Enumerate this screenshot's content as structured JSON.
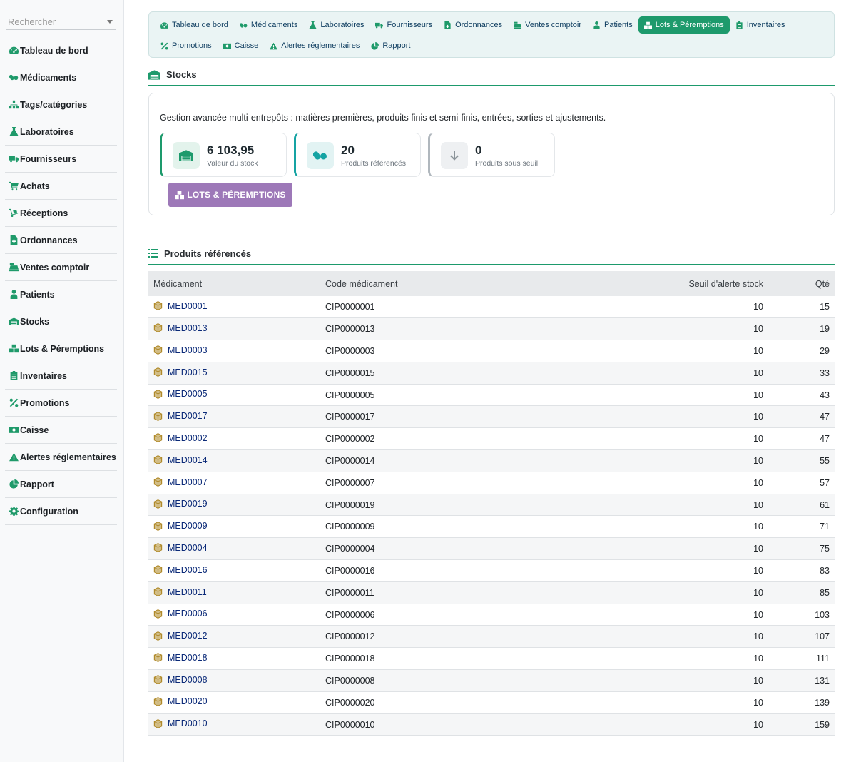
{
  "sidebar": {
    "search_placeholder": "Rechercher",
    "items": [
      {
        "label": "Tableau de bord",
        "icon": "dashboard-icon"
      },
      {
        "label": "Médicaments",
        "icon": "pills-icon"
      },
      {
        "label": "Tags/catégories",
        "icon": "sitemap-icon"
      },
      {
        "label": "Laboratoires",
        "icon": "flask-icon"
      },
      {
        "label": "Fournisseurs",
        "icon": "truck-icon"
      },
      {
        "label": "Achats",
        "icon": "cart-icon"
      },
      {
        "label": "Réceptions",
        "icon": "dolly-icon"
      },
      {
        "label": "Ordonnances",
        "icon": "prescription-icon"
      },
      {
        "label": "Ventes comptoir",
        "icon": "cash-register-icon"
      },
      {
        "label": "Patients",
        "icon": "patient-icon"
      },
      {
        "label": "Stocks",
        "icon": "warehouse-icon"
      },
      {
        "label": "Lots & Péremptions",
        "icon": "boxes-icon"
      },
      {
        "label": "Inventaires",
        "icon": "clipboard-icon"
      },
      {
        "label": "Promotions",
        "icon": "percent-icon"
      },
      {
        "label": "Caisse",
        "icon": "money-icon"
      },
      {
        "label": "Alertes réglementaires",
        "icon": "warning-icon"
      },
      {
        "label": "Rapport",
        "icon": "pie-chart-icon"
      },
      {
        "label": "Configuration",
        "icon": "gear-icon"
      }
    ]
  },
  "topnav": {
    "row1": [
      {
        "label": "Tableau de bord",
        "icon": "dashboard-icon",
        "active": false
      },
      {
        "label": "Médicaments",
        "icon": "pills-icon",
        "active": false
      },
      {
        "label": "Laboratoires",
        "icon": "flask-icon",
        "active": false
      },
      {
        "label": "Fournisseurs",
        "icon": "truck-icon",
        "active": false
      },
      {
        "label": "Ordonnances",
        "icon": "prescription-icon",
        "active": false
      },
      {
        "label": "Ventes comptoir",
        "icon": "cash-register-icon",
        "active": false
      },
      {
        "label": "Patients",
        "icon": "patient-icon",
        "active": false
      },
      {
        "label": "Lots & Péremptions",
        "icon": "boxes-icon",
        "active": true
      },
      {
        "label": "Inventaires",
        "icon": "clipboard-icon",
        "active": false
      }
    ],
    "row2": [
      {
        "label": "Promotions",
        "icon": "percent-icon",
        "active": false
      },
      {
        "label": "Caisse",
        "icon": "money-icon",
        "active": false
      },
      {
        "label": "Alertes réglementaires",
        "icon": "warning-icon",
        "active": false
      },
      {
        "label": "Rapport",
        "icon": "pie-chart-icon",
        "active": false
      }
    ]
  },
  "stocks": {
    "title": "Stocks",
    "description": "Gestion avancée multi-entrepôts : matières premières, produits finis et semi-finis, entrées, sorties et ajustements.",
    "stats": [
      {
        "value": "6 103,95",
        "label": "Valeur du stock",
        "icon": "warehouse-icon",
        "color": "#1d9a6c"
      },
      {
        "value": "20",
        "label": "Produits référencés",
        "icon": "pills-icon",
        "color": "#15a3a3"
      },
      {
        "value": "0",
        "label": "Produits sous seuil",
        "icon": "arrow-down-icon",
        "color": "#b0b7bd"
      }
    ],
    "lots_button": "LOTS & PÉREMPTIONS"
  },
  "products": {
    "title": "Produits référencés",
    "columns": [
      "Médicament",
      "Code médicament",
      "Seuil d'alerte stock",
      "Qté"
    ],
    "rows": [
      {
        "name": "MED0001",
        "code": "CIP0000001",
        "threshold": "10",
        "qty": "15"
      },
      {
        "name": "MED0013",
        "code": "CIP0000013",
        "threshold": "10",
        "qty": "19"
      },
      {
        "name": "MED0003",
        "code": "CIP0000003",
        "threshold": "10",
        "qty": "29"
      },
      {
        "name": "MED0015",
        "code": "CIP0000015",
        "threshold": "10",
        "qty": "33"
      },
      {
        "name": "MED0005",
        "code": "CIP0000005",
        "threshold": "10",
        "qty": "43"
      },
      {
        "name": "MED0017",
        "code": "CIP0000017",
        "threshold": "10",
        "qty": "47"
      },
      {
        "name": "MED0002",
        "code": "CIP0000002",
        "threshold": "10",
        "qty": "47"
      },
      {
        "name": "MED0014",
        "code": "CIP0000014",
        "threshold": "10",
        "qty": "55"
      },
      {
        "name": "MED0007",
        "code": "CIP0000007",
        "threshold": "10",
        "qty": "57"
      },
      {
        "name": "MED0019",
        "code": "CIP0000019",
        "threshold": "10",
        "qty": "61"
      },
      {
        "name": "MED0009",
        "code": "CIP0000009",
        "threshold": "10",
        "qty": "71"
      },
      {
        "name": "MED0004",
        "code": "CIP0000004",
        "threshold": "10",
        "qty": "75"
      },
      {
        "name": "MED0016",
        "code": "CIP0000016",
        "threshold": "10",
        "qty": "83"
      },
      {
        "name": "MED0011",
        "code": "CIP0000011",
        "threshold": "10",
        "qty": "85"
      },
      {
        "name": "MED0006",
        "code": "CIP0000006",
        "threshold": "10",
        "qty": "103"
      },
      {
        "name": "MED0012",
        "code": "CIP0000012",
        "threshold": "10",
        "qty": "107"
      },
      {
        "name": "MED0018",
        "code": "CIP0000018",
        "threshold": "10",
        "qty": "111"
      },
      {
        "name": "MED0008",
        "code": "CIP0000008",
        "threshold": "10",
        "qty": "131"
      },
      {
        "name": "MED0020",
        "code": "CIP0000020",
        "threshold": "10",
        "qty": "139"
      },
      {
        "name": "MED0010",
        "code": "CIP0000010",
        "threshold": "10",
        "qty": "159"
      }
    ]
  },
  "colors": {
    "accent": "#1d9a6c",
    "lots_button": "#9d78b8",
    "link": "#0b2a78",
    "box_icon": "#b08a2a"
  }
}
